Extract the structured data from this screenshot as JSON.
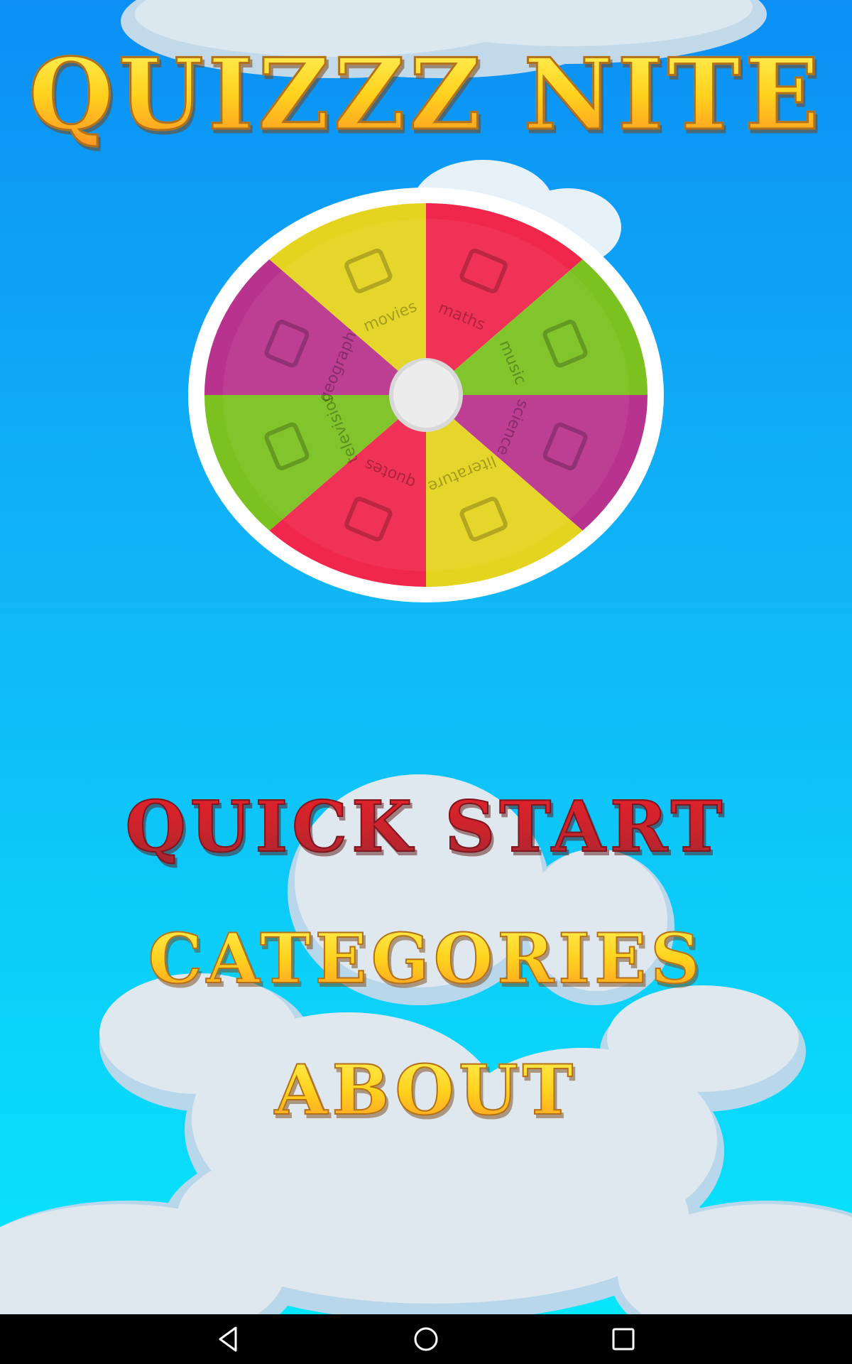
{
  "app": {
    "title": "QUIZZZ NITE"
  },
  "wheel": {
    "segments": [
      {
        "label": "maths",
        "color": "#f0264d",
        "icon": "calculator-icon"
      },
      {
        "label": "music",
        "color": "#7bc11f",
        "icon": "music-note-icon"
      },
      {
        "label": "science",
        "color": "#b8338e",
        "icon": "flask-icon"
      },
      {
        "label": "literature",
        "color": "#e5d41f",
        "icon": "book-icon"
      },
      {
        "label": "quotes",
        "color": "#f0264d",
        "icon": "quote-icon"
      },
      {
        "label": "television",
        "color": "#7bc11f",
        "icon": "tv-icon"
      },
      {
        "label": "geography",
        "color": "#b8338e",
        "icon": "globe-icon"
      },
      {
        "label": "movies",
        "color": "#e5d41f",
        "icon": "clapperboard-icon"
      }
    ]
  },
  "menu": {
    "quick_start": "QUICK START",
    "categories": "CATEGORIES",
    "about": "ABOUT"
  },
  "navbar": {
    "back": "back-triangle-icon",
    "home": "home-circle-icon",
    "recent": "recent-square-icon"
  }
}
